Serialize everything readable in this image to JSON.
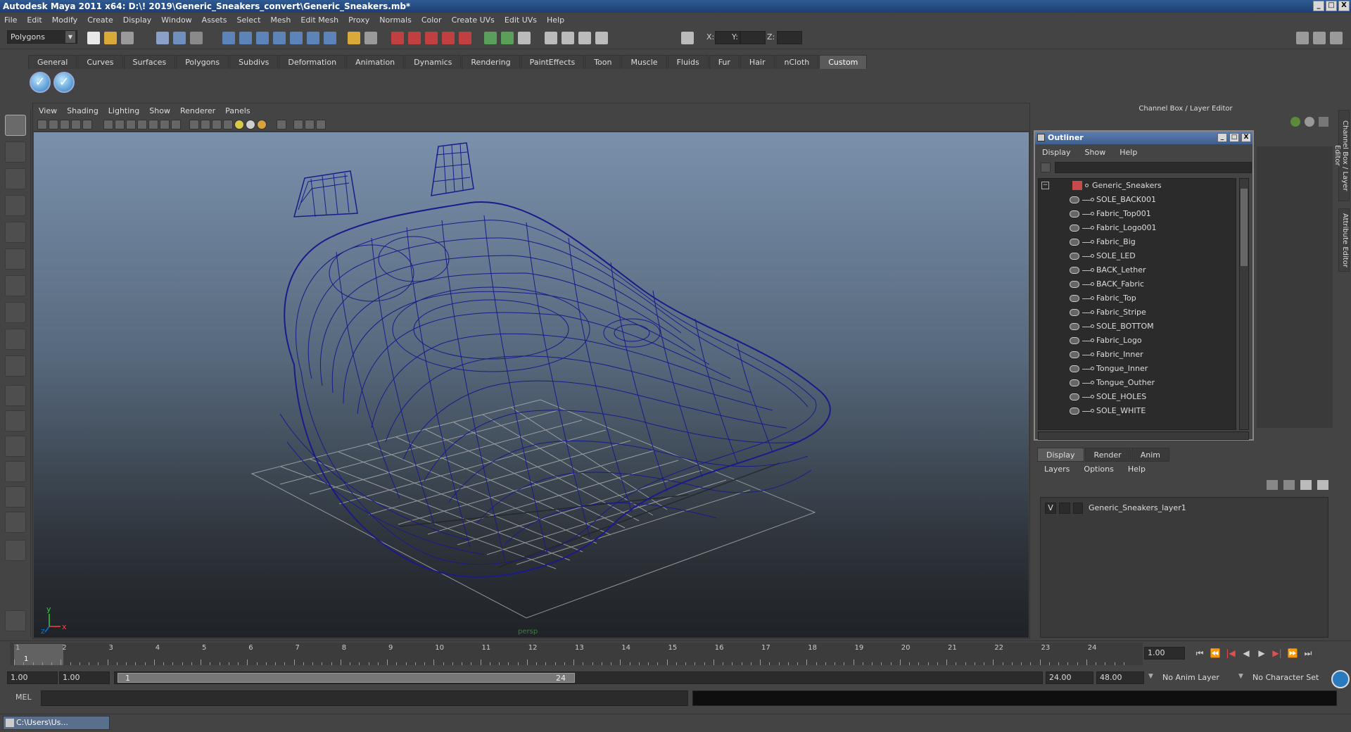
{
  "window": {
    "title": "Autodesk Maya 2011 x64: D:\\! 2019\\Generic_Sneakers_convert\\Generic_Sneakers.mb*",
    "controls": [
      "_",
      "□",
      "X"
    ]
  },
  "menubar": [
    "File",
    "Edit",
    "Modify",
    "Create",
    "Display",
    "Window",
    "Assets",
    "Select",
    "Mesh",
    "Edit Mesh",
    "Proxy",
    "Normals",
    "Color",
    "Create UVs",
    "Edit UVs",
    "Help"
  ],
  "status_line": {
    "menu_set": "Polygons",
    "x_label": "X:",
    "y_label": "Y:",
    "z_label": "Z:"
  },
  "shelf": {
    "tabs": [
      "General",
      "Curves",
      "Surfaces",
      "Polygons",
      "Subdivs",
      "Deformation",
      "Animation",
      "Dynamics",
      "Rendering",
      "PaintEffects",
      "Toon",
      "Muscle",
      "Fluids",
      "Fur",
      "Hair",
      "nCloth",
      "Custom"
    ],
    "active_tab": "Custom",
    "icons": [
      "check-icon",
      "check-icon"
    ]
  },
  "viewport": {
    "menu": [
      "View",
      "Shading",
      "Lighting",
      "Show",
      "Renderer",
      "Panels"
    ],
    "axis": {
      "y": "y",
      "x": "x",
      "z": "z"
    },
    "camera_label": "persp",
    "wire_color": "#1a1a8a"
  },
  "channel_box": {
    "title": "Channel Box / Layer Editor"
  },
  "outliner": {
    "title": "Outliner",
    "menu": [
      "Display",
      "Show",
      "Help"
    ],
    "root": "Generic_Sneakers",
    "items": [
      "SOLE_BACK001",
      "Fabric_Top001",
      "Fabric_Logo001",
      "Fabric_Big",
      "SOLE_LED",
      "BACK_Lether",
      "BACK_Fabric",
      "Fabric_Top",
      "Fabric_Stripe",
      "SOLE_BOTTOM",
      "Fabric_Logo",
      "Fabric_Inner",
      "Tongue_Inner",
      "Tongue_Outher",
      "SOLE_HOLES",
      "SOLE_WHITE"
    ]
  },
  "layer_editor": {
    "tabs": [
      "Display",
      "Render",
      "Anim"
    ],
    "active_tab": "Display",
    "menu": [
      "Layers",
      "Options",
      "Help"
    ],
    "layers": [
      {
        "visible": "V",
        "name": "Generic_Sneakers_layer1"
      }
    ]
  },
  "side_tabs": [
    "Channel Box / Layer Editor",
    "Attribute Editor"
  ],
  "time_slider": {
    "ticks": [
      "1",
      "2",
      "3",
      "4",
      "5",
      "6",
      "7",
      "8",
      "9",
      "10",
      "11",
      "12",
      "13",
      "14",
      "15",
      "16",
      "17",
      "18",
      "19",
      "20",
      "21",
      "22",
      "23",
      "24"
    ],
    "current_frame_marker": "1",
    "current_time": "1.00",
    "playback_buttons": [
      "⏮",
      "⏪",
      "|◀",
      "◀",
      "▶",
      "▶|",
      "⏩",
      "⏭"
    ]
  },
  "range_slider": {
    "start_time": "1.00",
    "playback_start": "1.00",
    "range_start_label": "1",
    "range_end_label": "24",
    "playback_end": "24.00",
    "end_time": "48.00",
    "anim_layer": "No Anim Layer",
    "character_set": "No Character Set"
  },
  "command_line": {
    "label": "MEL"
  },
  "taskbar": {
    "item": "C:\\Users\\Us..."
  }
}
